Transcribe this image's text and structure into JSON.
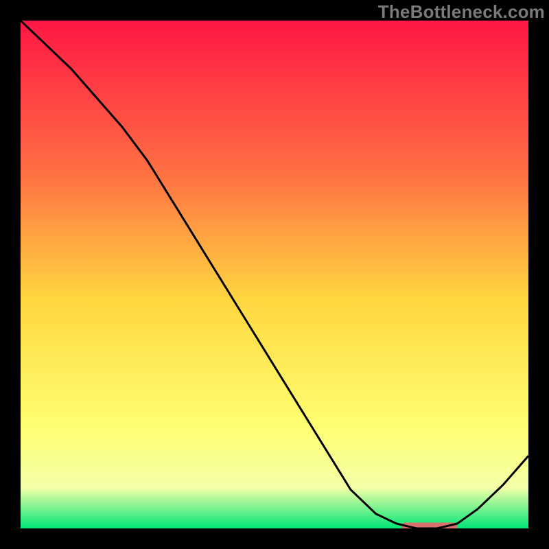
{
  "attribution": {
    "watermark": "TheBottleneck.com"
  },
  "colors": {
    "gradient_top": "#ff1744",
    "gradient_mid_upper": "#ff7043",
    "gradient_mid": "#ffd740",
    "gradient_mid_lower": "#ffff72",
    "gradient_band": "#f4ffa8",
    "gradient_bottom": "#00e676",
    "curve": "#000000",
    "marker": "#d8706e",
    "frame_bg": "#000000"
  },
  "chart_data": {
    "type": "line",
    "title": "",
    "xlabel": "",
    "ylabel": "",
    "xlim": [
      0,
      100
    ],
    "ylim": [
      0,
      105
    ],
    "x": [
      0,
      5,
      10,
      15,
      20,
      25,
      30,
      35,
      40,
      45,
      50,
      55,
      60,
      65,
      70,
      74,
      78,
      82,
      86,
      90,
      95,
      100
    ],
    "values": [
      105,
      100,
      95,
      89,
      83,
      76,
      67.5,
      59,
      50.5,
      42,
      33.5,
      25,
      16.5,
      8,
      3,
      1,
      0,
      0,
      1,
      4,
      9,
      15
    ],
    "marker": {
      "x_start": 75,
      "x_end": 86,
      "y": 0.5,
      "color": "#d8706e"
    },
    "annotations": []
  }
}
